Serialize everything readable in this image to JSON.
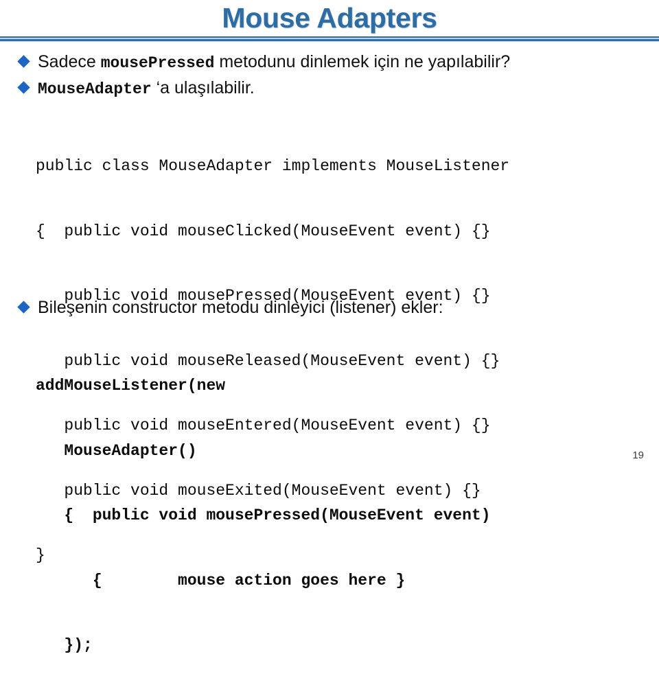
{
  "slide": {
    "title": "Mouse Adapters",
    "page_number": "19",
    "accent_color": "#2E6CA4",
    "bullet_color": "#1F63C4",
    "background_color": "#FFFFFF",
    "text_color": "#111111"
  },
  "bullets": [
    {
      "id": "bullet-1",
      "icon": "diamond-bullet",
      "segments": [
        {
          "text": "Sadece ",
          "style": "sans"
        },
        {
          "text": "mousePressed",
          "style": "mono-bold"
        },
        {
          "text": " metodunu dinlemek için ne yapılabilir?",
          "style": "sans"
        }
      ],
      "plain": "Sadece mousePressed metodunu dinlemek için ne yapılabilir?"
    },
    {
      "id": "bullet-2",
      "icon": "diamond-bullet",
      "segments": [
        {
          "text": "MouseAdapter",
          "style": "mono-bold"
        },
        {
          "text": "  ‘a ulaşılabilir.",
          "style": "sans"
        }
      ],
      "plain": "MouseAdapter  ‘a ulaşılabilir."
    },
    {
      "id": "bullet-3",
      "icon": "diamond-bullet",
      "segments": [
        {
          "text": "Bileşenin constructor metodu dinleyici (listener) ekler:",
          "style": "sans"
        }
      ],
      "plain": "Bileşenin constructor metodu dinleyici (listener) ekler:"
    }
  ],
  "code_block_1": {
    "lines": [
      "public class MouseAdapter implements MouseListener",
      "{  public void mouseClicked(MouseEvent event) {}",
      "   public void mousePressed(MouseEvent event) {}",
      "   public void mouseReleased(MouseEvent event) {}",
      "   public void mouseEntered(MouseEvent event) {}",
      "   public void mouseExited(MouseEvent event) {}",
      "}"
    ],
    "text": "public class MouseAdapter implements MouseListener\n{  public void mouseClicked(MouseEvent event) {}\n   public void mousePressed(MouseEvent event) {}\n   public void mouseReleased(MouseEvent event) {}\n   public void mouseEntered(MouseEvent event) {}\n   public void mouseExited(MouseEvent event) {}\n}"
  },
  "code_block_2": {
    "lines": [
      "addMouseListener(new",
      "   MouseAdapter()",
      "   {  public void mousePressed(MouseEvent event)",
      "      {        mouse action goes here }",
      "   });"
    ],
    "text": "addMouseListener(new\n   MouseAdapter()\n   {  public void mousePressed(MouseEvent event)\n      {        mouse action goes here }\n   });"
  }
}
